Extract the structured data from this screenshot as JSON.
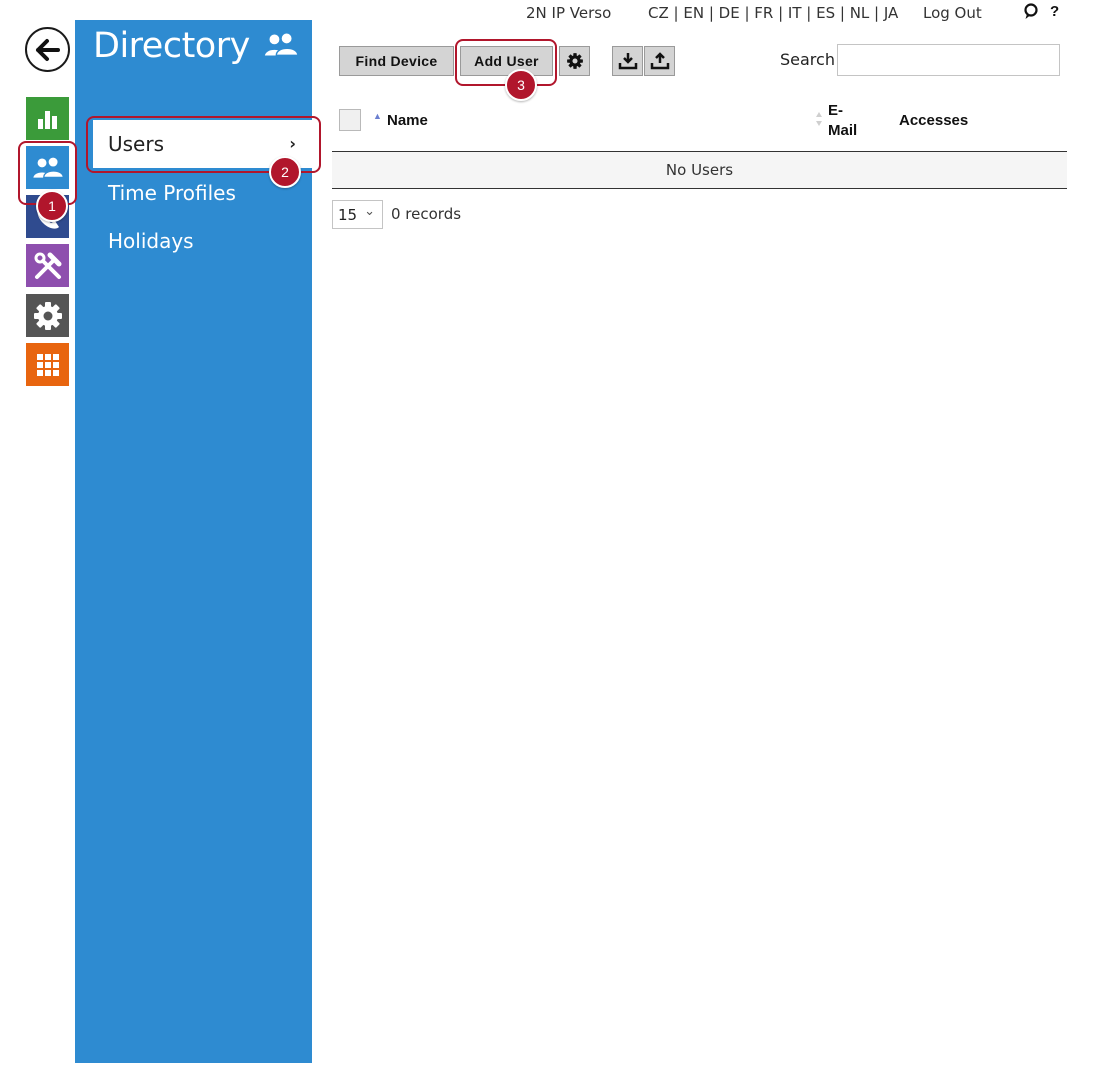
{
  "header": {
    "device_name": "2N IP Verso",
    "languages": [
      "CZ",
      "EN",
      "DE",
      "FR",
      "IT",
      "ES",
      "NL",
      "JA"
    ],
    "logout_label": "Log Out",
    "help_label": "?"
  },
  "rail": {
    "items": [
      "back-arrow-icon",
      "status-chart-icon",
      "directory-users-icon",
      "phone-icon",
      "services-tools-icon",
      "settings-gear-icon",
      "system-grid-icon"
    ],
    "colors": {
      "status": "#3b9b3a",
      "directory": "#2e8bd1",
      "phone": "#2f4b8f",
      "services": "#8e4fae",
      "settings": "#555555",
      "system": "#e8650f"
    }
  },
  "directory": {
    "title": "Directory",
    "title_icon": "users-icon",
    "nav": [
      {
        "label": "Users",
        "active": true
      },
      {
        "label": "Time Profiles",
        "active": false
      },
      {
        "label": "Holidays",
        "active": false
      }
    ],
    "chevron": "›"
  },
  "toolbar": {
    "find_device_label": "Find Device",
    "add_user_label": "Add User",
    "settings_icon": "gear-icon",
    "import_icon": "download-icon",
    "export_icon": "upload-icon",
    "search_label": "Search",
    "search_value": ""
  },
  "table": {
    "columns": [
      "Name",
      "E-\nMail",
      "Accesses"
    ],
    "empty_message": "No Users",
    "page_size": "15",
    "page_size_chevron": "⌄",
    "records_text": "0 records"
  },
  "annotations": [
    "1",
    "2",
    "3"
  ],
  "accent_color": "#b1162c"
}
